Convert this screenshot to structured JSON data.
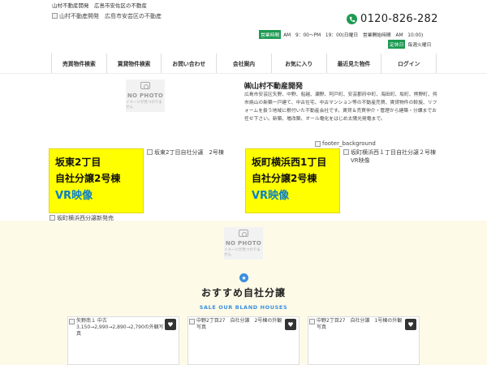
{
  "header": {
    "tagline_company": "山村不動産開発",
    "tagline_area": "広島市安佐区の不動産",
    "logo_alt": "山村不動産開発　広島市安芸区の不動産",
    "phone": "0120-826-282",
    "hours_badge": "営業時間",
    "hours_text": "AM　9：00～PM　19：00(日曜日　営業開始時間　AM　10:00)",
    "holiday_badge": "定休日",
    "holiday_text": "毎週火曜日"
  },
  "nav": [
    "売買物件検索",
    "賃貸物件検索",
    "お問い合わせ",
    "会社案内",
    "お気に入り",
    "最近見た物件",
    "ログイン"
  ],
  "company": {
    "name": "㈱山村不動産開発",
    "description": "広島市安芸区矢野、中野、船越、瀬野、阿戸町、安芸郡府中町、海田町、坂町、熊野町、呉市焼山の新築一戸建て、中古住宅、中古マンション等の不動産売買、賃貸物件の斡旋、リフォームを扱う地域に根付いた不動産会社です。賃貸＆売買仲介・管理から建築・分譲までお任せ下さい。新築、増改築、オール電化をはじめ太陽光発電まで。"
  },
  "no_photo": {
    "title": "NO PHOTO",
    "sub": "イメージが見つかりません"
  },
  "banners": [
    {
      "line1": "坂東2丁目",
      "line2": "自社分譲2号棟",
      "line3": "VR映像",
      "alt": "坂東2丁目自社分譲　2号棟"
    },
    {
      "line1": "坂町横浜西1丁目",
      "line2": "自社分譲2号棟",
      "line3": "VR映像",
      "alt": "坂町横浜西１丁目自社分譲２号棟VR映像"
    }
  ],
  "footer_bg_alt": "footer_background",
  "yokohama_alt": "坂町横浜西分譲新発売",
  "recommend": {
    "title": "おすすめ自社分譲",
    "subtitle": "SALE OUR BLAND HOUSES"
  },
  "cards": [
    {
      "alt": "矢野南１ 中古 3,150→2,990→2,890→2,790の外観写真"
    },
    {
      "alt": "中野2丁目27　自社分譲　2号棟の外観写真"
    },
    {
      "alt": "中野2丁目27　自社分譲　1号棟の外観写真"
    }
  ],
  "colors": {
    "accent_green": "#1e9a52",
    "banner_yellow": "#ffff00",
    "vr_blue": "#0a7fc9",
    "cream_bg": "#fdfbe8"
  }
}
